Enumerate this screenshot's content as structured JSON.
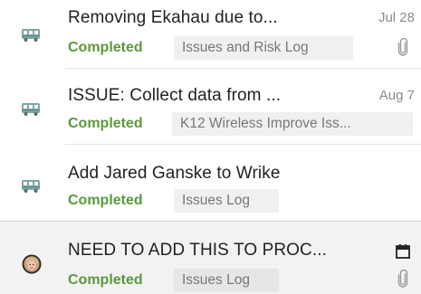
{
  "tasks": [
    {
      "title": "Removing Ekahau due to...",
      "status": "Completed",
      "folder": "Issues and Risk Log",
      "date": "Jul 28",
      "avatar": "bus-icon",
      "has_attachment": true
    },
    {
      "title": "ISSUE: Collect data from ...",
      "status": "Completed",
      "folder": "K12 Wireless Improve Iss...",
      "date": "Aug 7",
      "avatar": "bus-icon",
      "has_attachment": false
    },
    {
      "title": "Add Jared Ganske to Wrike",
      "status": "Completed",
      "folder": "Issues Log",
      "date": "",
      "avatar": "bus-icon",
      "has_attachment": false
    },
    {
      "title": "NEED TO ADD THIS TO PROC...",
      "status": "Completed",
      "folder": "Issues Log",
      "date": "",
      "avatar": "user-photo-avatar",
      "has_attachment": true,
      "has_calendar": true
    }
  ],
  "colors": {
    "status_completed": "#5a9a3a",
    "bus_icon": "#7da7a4",
    "selected_row_bg": "#f2f2f2"
  }
}
